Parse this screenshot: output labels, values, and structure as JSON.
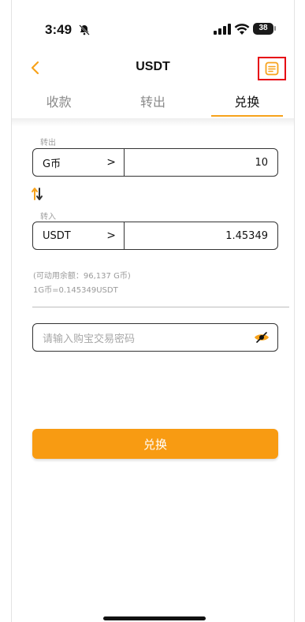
{
  "status_bar": {
    "time": "3:49",
    "battery": "38"
  },
  "header": {
    "title": "USDT"
  },
  "tabs": [
    {
      "label": "收款",
      "active": false
    },
    {
      "label": "转出",
      "active": false
    },
    {
      "label": "兑换",
      "active": true
    }
  ],
  "form": {
    "from_label": "转出",
    "from_currency": "G币",
    "from_amount": "10",
    "to_label": "转入",
    "to_currency": "USDT",
    "to_amount": "1.45349",
    "available_balance": "(可动用余额：96,137 G币)",
    "rate": "1G币=0.145349USDT",
    "password_placeholder": "请输入购宝交易密码",
    "submit_label": "兑换"
  },
  "colors": {
    "accent": "#f89b12",
    "highlight_border": "#e60012"
  },
  "icons": {
    "back": "chevron-left-icon",
    "records": "document-list-icon",
    "swap": "swap-vertical-icon",
    "eye": "eye-hidden-icon",
    "select": "chevron-right-icon"
  }
}
